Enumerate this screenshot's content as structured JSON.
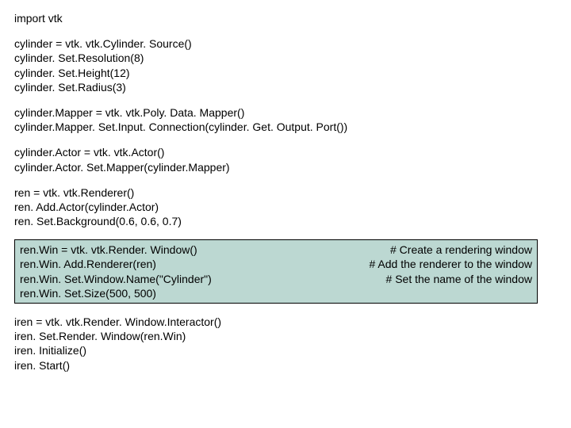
{
  "blocks": [
    [
      "import vtk"
    ],
    [
      "cylinder = vtk. vtk.Cylinder. Source()",
      "cylinder. Set.Resolution(8)",
      "cylinder. Set.Height(12)",
      "cylinder. Set.Radius(3)"
    ],
    [
      "cylinder.Mapper = vtk. vtk.Poly. Data. Mapper()",
      "cylinder.Mapper. Set.Input. Connection(cylinder. Get. Output. Port())"
    ],
    [
      "cylinder.Actor = vtk. vtk.Actor()",
      "cylinder.Actor. Set.Mapper(cylinder.Mapper)"
    ],
    [
      "ren = vtk. vtk.Renderer()",
      "ren. Add.Actor(cylinder.Actor)",
      "ren. Set.Background(0.6, 0.6, 0.7)"
    ]
  ],
  "highlight": {
    "rows": [
      {
        "left": "ren.Win = vtk. vtk.Render. Window()",
        "right": "# Create a rendering window"
      },
      {
        "left": "ren.Win. Add.Renderer(ren)",
        "right": "# Add the renderer to the window"
      },
      {
        "left": "ren.Win. Set.Window.Name(\"Cylinder\")",
        "right": "# Set the name of the window"
      },
      {
        "left": "ren.Win. Set.Size(500, 500)",
        "right": ""
      }
    ]
  },
  "after": [
    "iren = vtk. vtk.Render. Window.Interactor()",
    "iren. Set.Render. Window(ren.Win)",
    "iren. Initialize()",
    "iren. Start()"
  ]
}
